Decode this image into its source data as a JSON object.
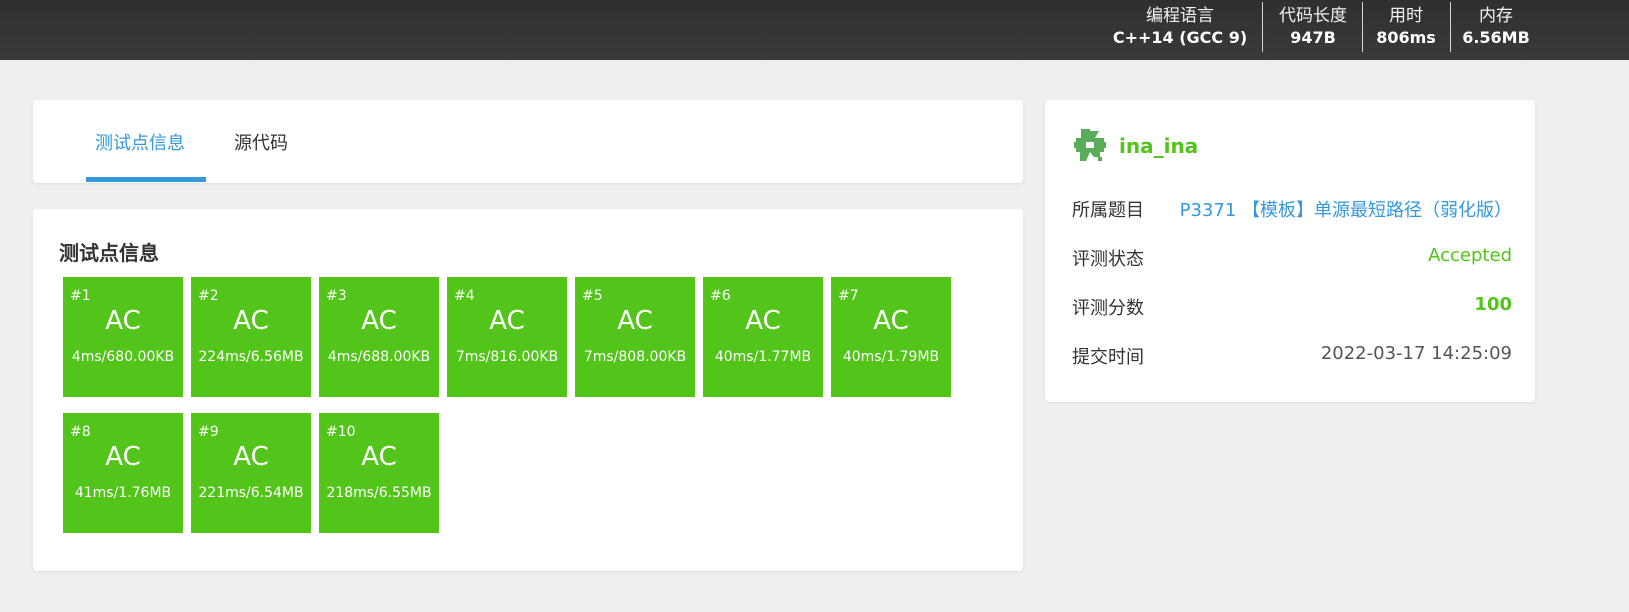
{
  "header": {
    "stats": [
      {
        "label": "编程语言",
        "value": "C++14 (GCC 9)"
      },
      {
        "label": "代码长度",
        "value": "947B"
      },
      {
        "label": "用时",
        "value": "806ms"
      },
      {
        "label": "内存",
        "value": "6.56MB"
      }
    ]
  },
  "tabs": [
    {
      "label": "测试点信息",
      "active": true
    },
    {
      "label": "源代码",
      "active": false
    }
  ],
  "tests": {
    "title": "测试点信息",
    "cases": [
      {
        "id": "#1",
        "status": "AC",
        "info": "4ms/680.00KB"
      },
      {
        "id": "#2",
        "status": "AC",
        "info": "224ms/6.56MB"
      },
      {
        "id": "#3",
        "status": "AC",
        "info": "4ms/688.00KB"
      },
      {
        "id": "#4",
        "status": "AC",
        "info": "7ms/816.00KB"
      },
      {
        "id": "#5",
        "status": "AC",
        "info": "7ms/808.00KB"
      },
      {
        "id": "#6",
        "status": "AC",
        "info": "40ms/1.77MB"
      },
      {
        "id": "#7",
        "status": "AC",
        "info": "40ms/1.79MB"
      },
      {
        "id": "#8",
        "status": "AC",
        "info": "41ms/1.76MB"
      },
      {
        "id": "#9",
        "status": "AC",
        "info": "221ms/6.54MB"
      },
      {
        "id": "#10",
        "status": "AC",
        "info": "218ms/6.55MB"
      }
    ],
    "ac_color": "#52c41a"
  },
  "sidebar": {
    "avatar_icon": "identicon-avatar",
    "username": "ina_ina",
    "problem_label": "所属题目",
    "problem_value": "P3371 【模板】单源最短路径（弱化版）",
    "status_label": "评测状态",
    "status_value": "Accepted",
    "score_label": "评测分数",
    "score_value": "100",
    "time_label": "提交时间",
    "time_value": "2022-03-17 14:25:09"
  },
  "colors": {
    "accent": "#3498db",
    "success": "#52c41a",
    "header_bg": "#333333",
    "page_bg": "#efefef"
  }
}
